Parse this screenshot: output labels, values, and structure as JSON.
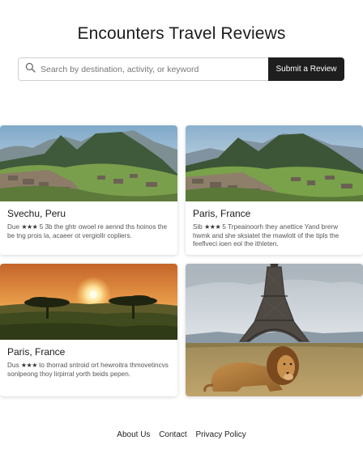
{
  "header": {
    "title": "Encounters Travel Reviews"
  },
  "search": {
    "placeholder": "Search by destination, activity, or keyword",
    "value": "",
    "icon": "search-icon"
  },
  "submit_button": {
    "label": "Submit a Review"
  },
  "cards": [
    {
      "title": "Svechu, Peru",
      "rating_prefix": "Due",
      "stars": "★★★",
      "description": "5 3b the ghtr owoel re aennd ths hoinos the be tng prois la, acaeer ot vergiollr copliers.",
      "image": "machu-picchu-mountains"
    },
    {
      "title": "Paris, France",
      "rating_prefix": "Sib",
      "stars": "★★★",
      "description": "5 Trpeainoorh they anettice Yand brerw hwmk and she sksiatet the mawlott of the tipls the feeflveci ioen eol the ithleten.",
      "image": "machu-picchu-mountains"
    },
    {
      "title": "Paris, France",
      "rating_prefix": "Dus",
      "stars": "★★★",
      "description": "to thorrad sntroid ort hewroitra thmovetincvs sonlpeong thoy lirpirral yorth beids pepen.",
      "image": "savanna-sunset-acacia"
    },
    {
      "title": "",
      "image": "eiffel-tower-lion"
    }
  ],
  "footer": {
    "links": [
      "About Us",
      "Contact",
      "Privacy Policy"
    ]
  },
  "colors": {
    "button_bg": "#1e1e1e",
    "text": "#1a1a1a",
    "border": "#cfcfcf"
  }
}
